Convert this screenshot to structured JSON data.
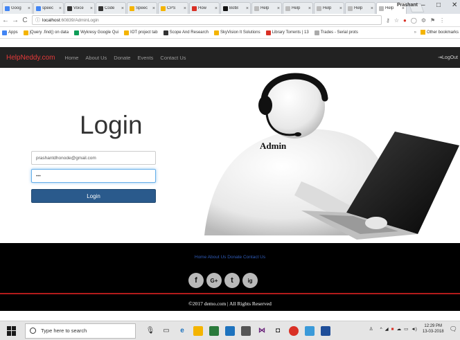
{
  "browser": {
    "tabs": [
      {
        "title": "Goog",
        "color": "#4285f4",
        "active": false
      },
      {
        "title": "speec",
        "color": "#4285f4",
        "active": false
      },
      {
        "title": "Voice",
        "color": "#333333",
        "active": false
      },
      {
        "title": "Code",
        "color": "#333333",
        "active": false
      },
      {
        "title": "Speec",
        "color": "#f4b400",
        "active": false
      },
      {
        "title": "CPS",
        "color": "#f4b400",
        "active": false
      },
      {
        "title": "How",
        "color": "#d93025",
        "active": false
      },
      {
        "title": "BotB",
        "color": "#111111",
        "active": false
      },
      {
        "title": "Help",
        "color": "#bbbbbb",
        "active": false
      },
      {
        "title": "Help",
        "color": "#bbbbbb",
        "active": false
      },
      {
        "title": "Help",
        "color": "#bbbbbb",
        "active": false
      },
      {
        "title": "Help",
        "color": "#bbbbbb",
        "active": false
      },
      {
        "title": "Help",
        "color": "#bbbbbb",
        "active": true
      }
    ],
    "user_label": "Prashant",
    "window_controls": {
      "minimize": "–",
      "maximize": "□",
      "close": "✕"
    },
    "nav": {
      "back": "←",
      "forward": "→",
      "reload": "C"
    },
    "url_host": "localhost",
    "url_path": ":60839/AdminLogin",
    "url_info_icon": "ⓘ",
    "bookmarks": [
      {
        "label": "Apps",
        "color": "#4285f4"
      },
      {
        "label": "jQuery .find() on data",
        "color": "#f4b400"
      },
      {
        "label": "Wykresy Google Qui",
        "color": "#0f9d58"
      },
      {
        "label": "IOT project tab",
        "color": "#f4b400"
      },
      {
        "label": "Scope And Research",
        "color": "#333333"
      },
      {
        "label": "SkyVision It Solutions",
        "color": "#f4b400"
      },
      {
        "label": "Library Torrents | 13",
        "color": "#d93025"
      },
      {
        "label": "Trades - Serial prots",
        "color": "#aaaaaa"
      }
    ],
    "other_bookmarks": "Other bookmarks"
  },
  "site": {
    "brand": "HelpNeddy.com",
    "nav_links": [
      "Home",
      "About Us",
      "Donate",
      "Events",
      "Contact Us"
    ],
    "logout": "LogOut",
    "login_title": "Login",
    "email_value": "prashantdhonode@gmail.com",
    "password_value": "•••",
    "login_button": "Login",
    "hero_label": "Admin",
    "footer_links": "Home About Us Donate Contact Us",
    "social": [
      "f",
      "G+",
      "t",
      "ig"
    ],
    "copyright": "©2017   demo.com   |   All   Rights   Reserved"
  },
  "taskbar": {
    "search_placeholder": "Type here to search",
    "time": "12:29 PM",
    "date": "13-03-2018"
  }
}
